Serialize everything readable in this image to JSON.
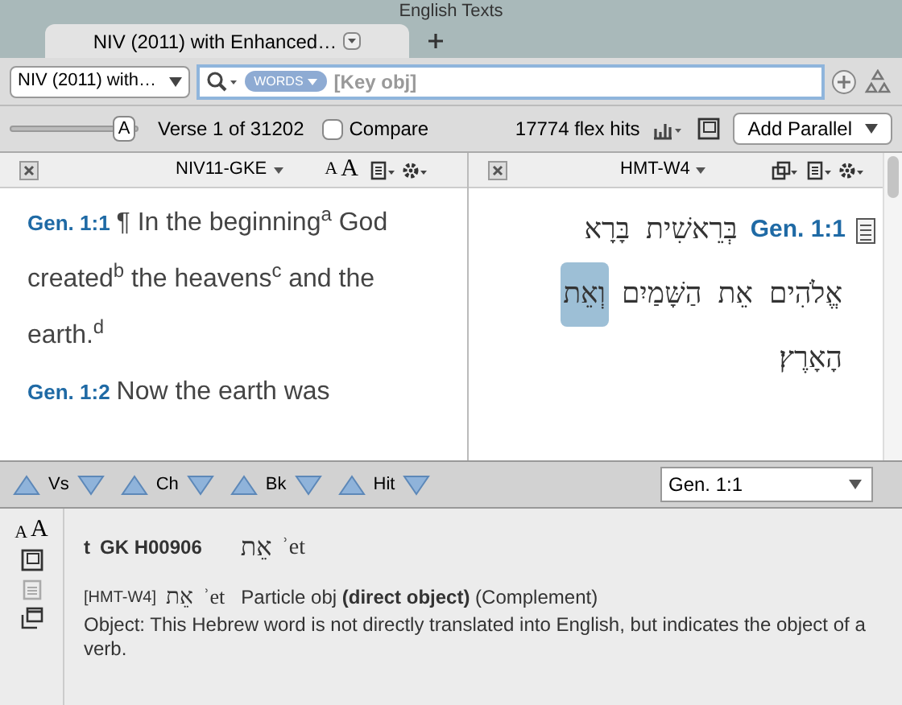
{
  "window": {
    "title": "English Texts"
  },
  "tabs": [
    {
      "label": "NIV (2011) with Enhanced…",
      "selected": true
    }
  ],
  "search": {
    "version": "NIV (2011) with…",
    "mode": "WORDS",
    "value": "[Key obj]"
  },
  "toolbar": {
    "slider": {
      "label": "A",
      "level": 0.95
    },
    "verse": "Verse 1 of 31202",
    "compare": {
      "label": "Compare",
      "checked": false
    },
    "hits": "17774 flex hits",
    "add_parallel": "Add Parallel"
  },
  "left_pane": {
    "title": "NIV11-GKE",
    "font_small": "A",
    "font_large": "A",
    "verses": [
      {
        "ref": "Gen. 1:1",
        "text": "¶ In the beginning$^{a}$ God created$^{b}$ the heavens$^{c}$ and the earth.$^{d}$"
      },
      {
        "ref": "Gen. 1:2",
        "text": "Now the earth was"
      }
    ]
  },
  "right_pane": {
    "title": "HMT-W4",
    "ref": "Gen. 1:1",
    "lines": [
      [
        {
          "word": "בְּרֵאשִׁית",
          "selected": false
        },
        {
          "word": "בָּרָא",
          "selected": false
        }
      ],
      [
        {
          "word": "אֱלֹהִים",
          "selected": false
        },
        {
          "word": "אֵת",
          "selected": false
        },
        {
          "word": "הַשָּׁמַיִם",
          "selected": false
        },
        {
          "word": "וְאֵת",
          "selected": true
        }
      ],
      [
        {
          "word": "הָאָרֶץ׃",
          "selected": false
        }
      ]
    ]
  },
  "nav": {
    "buttons": [
      "Vs",
      "Ch",
      "Bk",
      "Hit"
    ],
    "reference": "Gen. 1:1"
  },
  "info": {
    "font_small": "A",
    "font_large": "A",
    "entry": {
      "prefix": "t",
      "number": "GK H00906",
      "hebrew": "אֵת",
      "translit": "ʾet"
    },
    "detail": {
      "source": "[HMT-W4]",
      "hebrew": "אֵת",
      "translit": "ʾet",
      "parsing": "Particle obj **(direct object)** (Complement)"
    },
    "definition": "Object: This Hebrew word is not directly translated into English, but indicates the object of a verb."
  }
}
